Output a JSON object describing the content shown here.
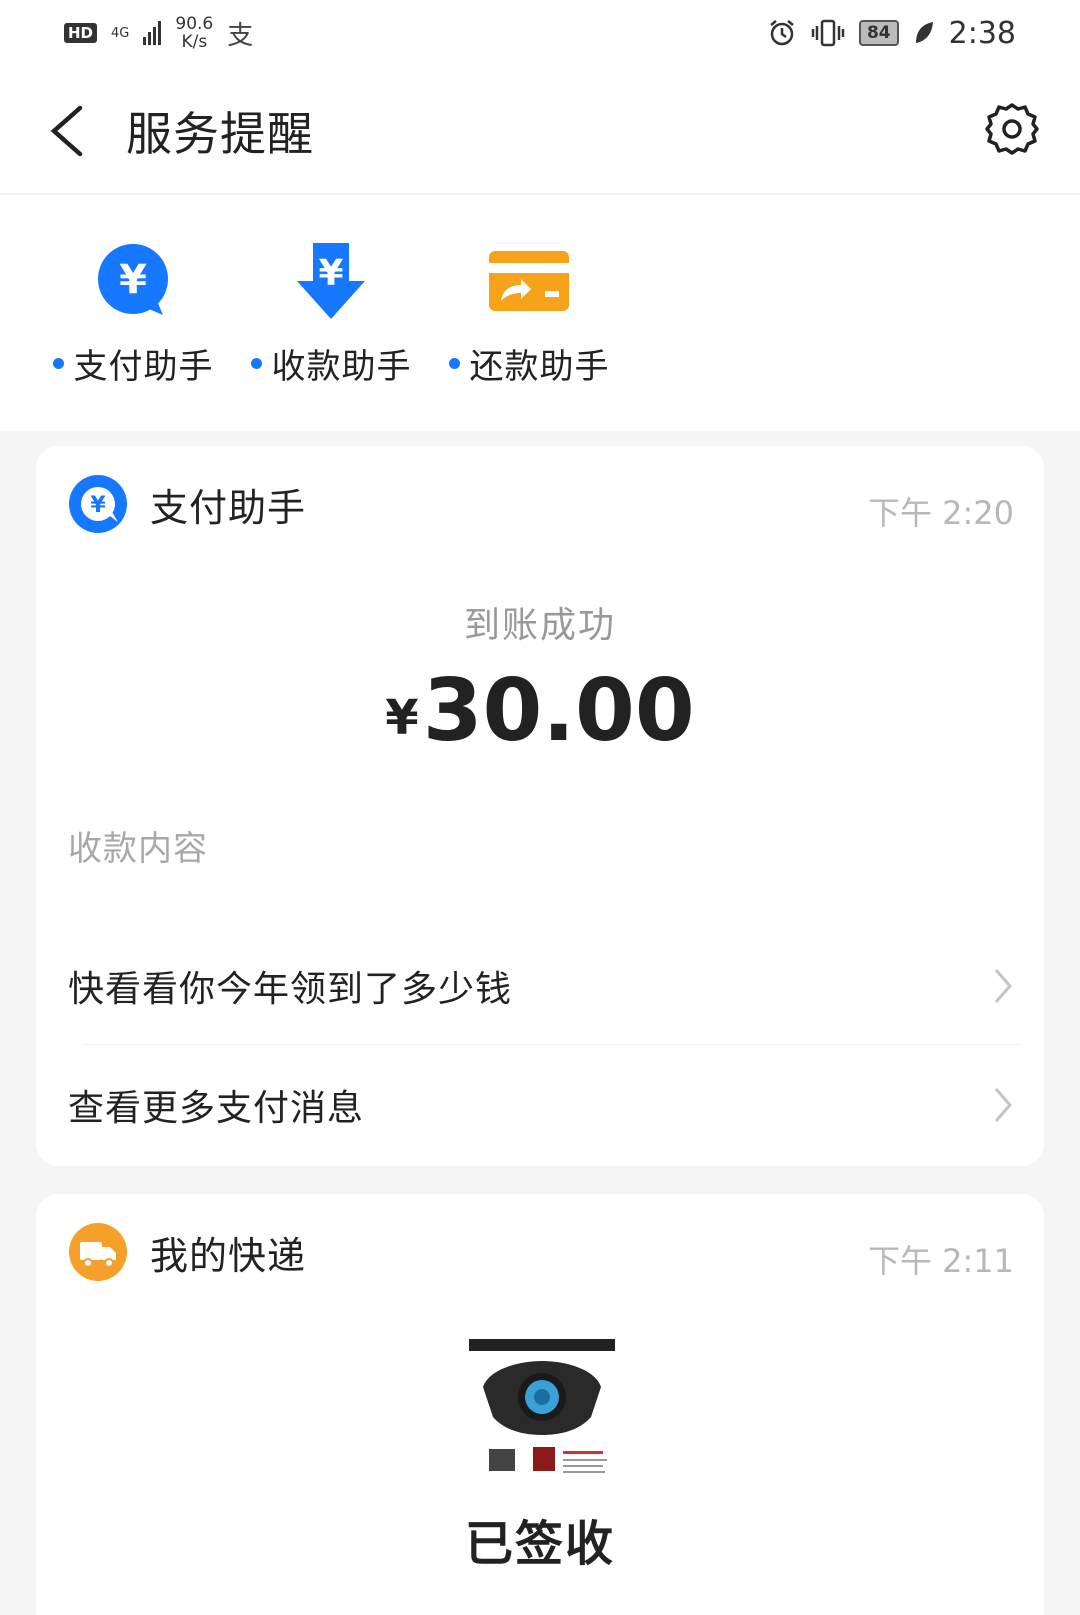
{
  "status_bar": {
    "hd": "HD",
    "network": "4G",
    "speed_value": "90.6",
    "speed_unit": "K/s",
    "pay_glyph": "支",
    "battery": "84",
    "time": "2:38"
  },
  "header": {
    "title": "服务提醒",
    "back_icon": "chevron-left-icon",
    "settings_icon": "gear-icon"
  },
  "assistants": [
    {
      "label": "支付助手",
      "icon": "payment-assistant-icon",
      "color": "#1677ff"
    },
    {
      "label": "收款助手",
      "icon": "receive-assistant-icon",
      "color": "#1677ff"
    },
    {
      "label": "还款助手",
      "icon": "repayment-assistant-icon",
      "color": "#f7a21b"
    }
  ],
  "payment_card": {
    "title": "支付助手",
    "time": "下午 2:20",
    "status": "到账成功",
    "currency": "¥",
    "amount": "30.00",
    "content_label": "收款内容",
    "links": [
      {
        "label": "快看看你今年领到了多少钱"
      },
      {
        "label": "查看更多支付消息"
      }
    ],
    "accent": "#1677ff"
  },
  "parcel_card": {
    "title": "我的快递",
    "time": "下午 2:11",
    "status": "已签收",
    "accent": "#f5a02a"
  }
}
